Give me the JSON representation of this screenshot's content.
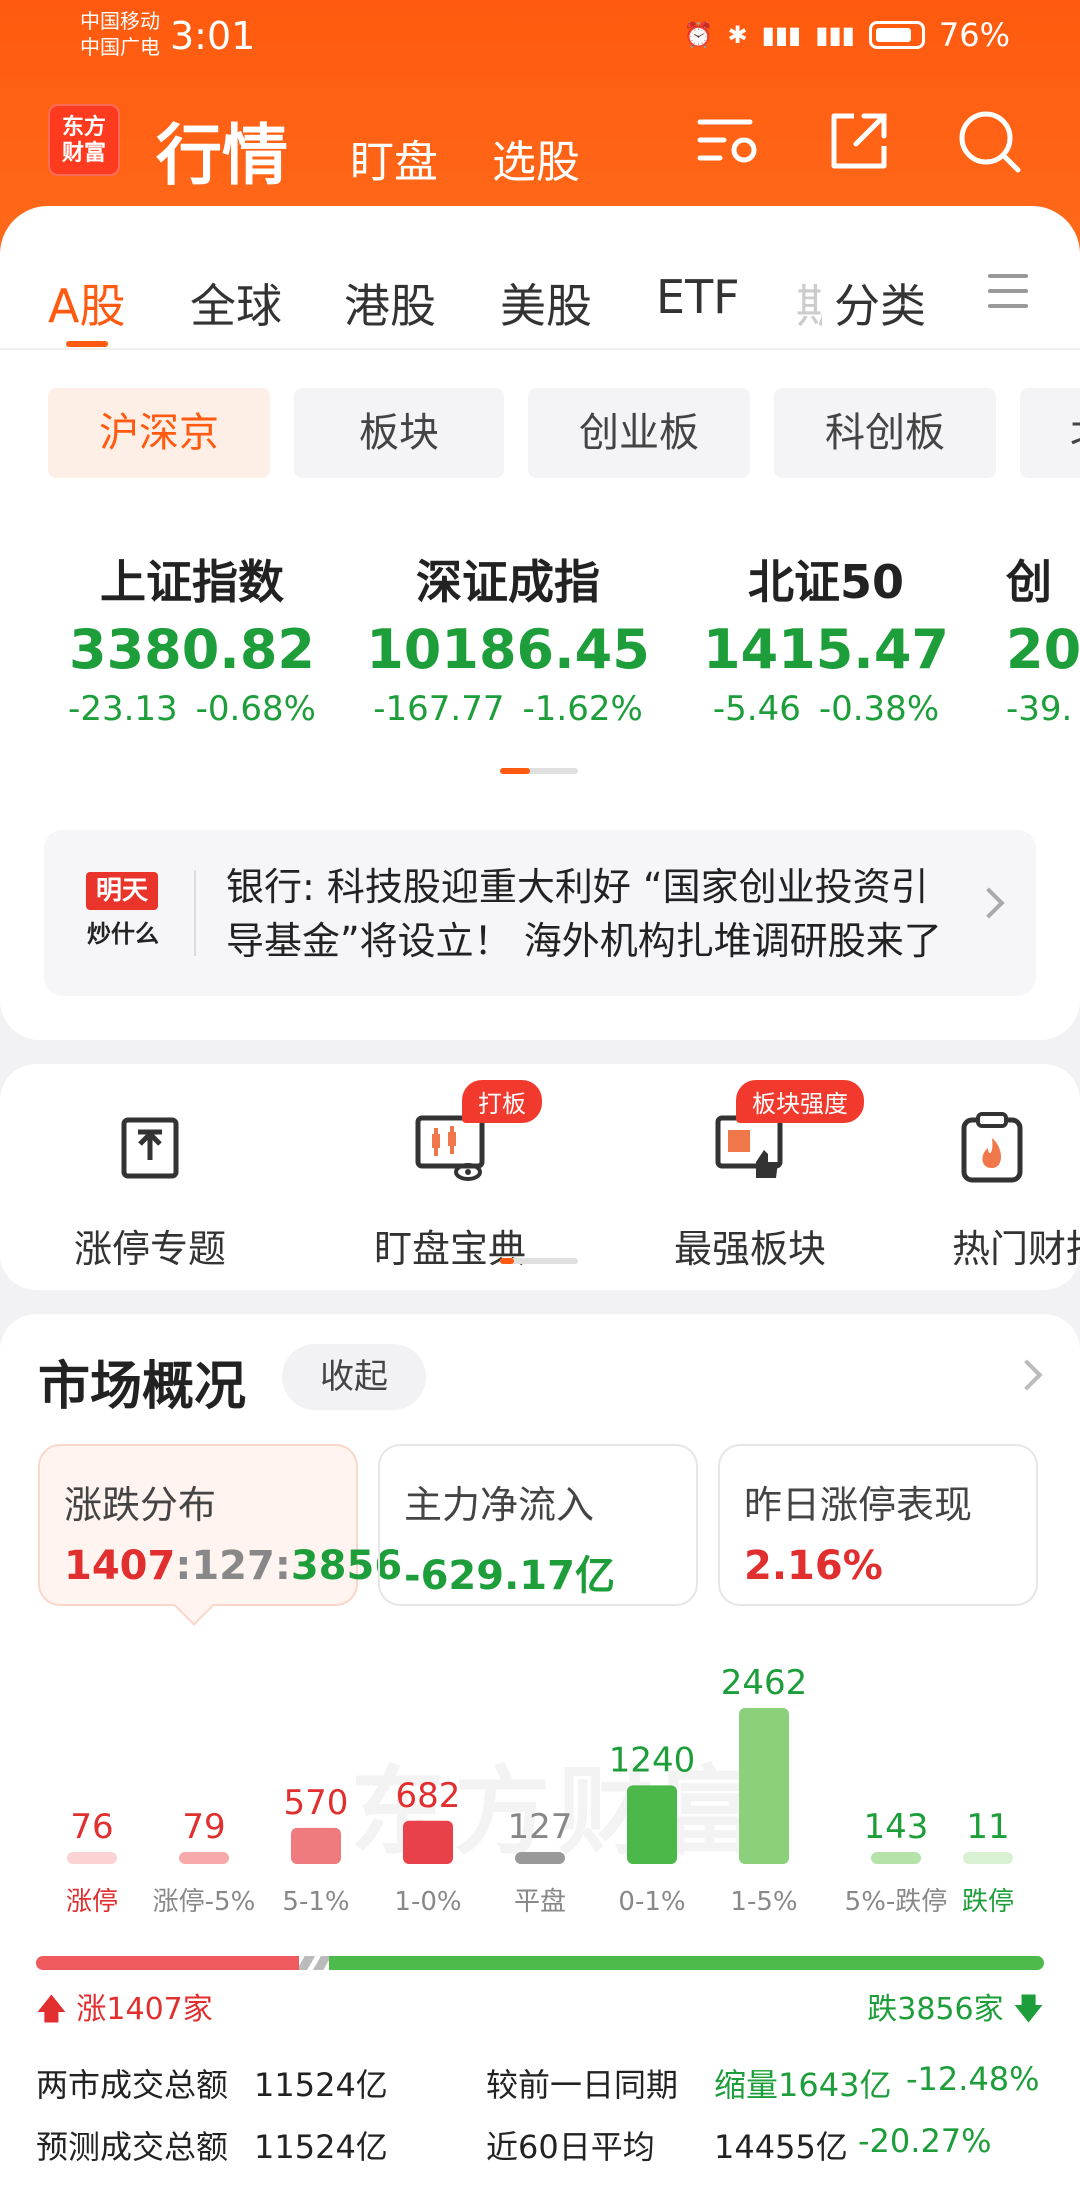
{
  "status_bar": {
    "carrier1": "中国移动",
    "carrier2": "中国广电",
    "time": "3:01",
    "battery": "76%"
  },
  "header": {
    "logo_line1": "东方",
    "logo_line2": "财富",
    "title": "行情",
    "link_watch": "盯盘",
    "link_pick": "选股"
  },
  "tabs": [
    "A股",
    "全球",
    "港股",
    "美股",
    "ETF",
    "期",
    "分类"
  ],
  "subtabs": [
    "沪深京",
    "板块",
    "创业板",
    "科创板",
    "北"
  ],
  "indices": [
    {
      "name": "上证指数",
      "value": "3380.82",
      "change": "-23.13",
      "pct": "-0.68%"
    },
    {
      "name": "深证成指",
      "value": "10186.45",
      "change": "-167.77",
      "pct": "-1.62%"
    },
    {
      "name": "北证50",
      "value": "1415.47",
      "change": "-5.46",
      "pct": "-0.38%"
    },
    {
      "name": "创",
      "value": "20",
      "change": "-39.",
      "pct": ""
    }
  ],
  "news": {
    "logo_top": "明天",
    "logo_bottom": "炒什么",
    "text": "银行: 科技股迎重大利好 “国家创业投资引导基金”将设立！ 海外机构扎堆调研股来了"
  },
  "tools": [
    {
      "label": "涨停专题",
      "badge": ""
    },
    {
      "label": "盯盘宝典",
      "badge": "打板"
    },
    {
      "label": "最强板块",
      "badge": "板块强度"
    },
    {
      "label": "热门财报",
      "badge": ""
    }
  ],
  "market": {
    "title": "市场概况",
    "collapse": "收起",
    "stats": [
      {
        "title": "涨跌分布",
        "up": "1407",
        "flat": "127",
        "down": "3856"
      },
      {
        "title": "主力净流入",
        "value": "-629.17亿"
      },
      {
        "title": "昨日涨停表现",
        "value": "2.16%"
      }
    ],
    "watermark": "东方财富",
    "up_label": "涨1407家",
    "down_label": "跌3856家",
    "rows": [
      {
        "k1": "两市成交总额",
        "v1": "11524亿",
        "k2": "较前一日同期",
        "v2": "缩量1643亿",
        "v3": "-12.48%"
      },
      {
        "k1": "预测成交总额",
        "v1": "11524亿",
        "k2": "近60日平均",
        "v2": "14455亿",
        "v3": "-20.27%"
      }
    ]
  },
  "chart_data": {
    "type": "bar",
    "categories": [
      "涨停",
      "涨停-5%",
      "5-1%",
      "1-0%",
      "平盘",
      "0-1%",
      "1-5%",
      "5%-跌停",
      "跌停"
    ],
    "values": [
      76,
      79,
      570,
      682,
      127,
      1240,
      2462,
      143,
      11
    ],
    "colors": [
      "#fbd3d3",
      "#f6aaaa",
      "#ef7b7f",
      "#e8414a",
      "#999999",
      "#4cb84a",
      "#8bd07a",
      "#b5e2a8",
      "#d9f0d2"
    ],
    "label_colors": [
      "#e12e2e",
      "#e12e2e",
      "#e12e2e",
      "#e12e2e",
      "#888888",
      "#1d9e3a",
      "#1d9e3a",
      "#1d9e3a",
      "#1d9e3a"
    ],
    "ylim": [
      0,
      2462
    ]
  },
  "colors": {
    "brand": "#ff5a0f",
    "rise": "#e12e2e",
    "fall": "#1d9e3a"
  }
}
